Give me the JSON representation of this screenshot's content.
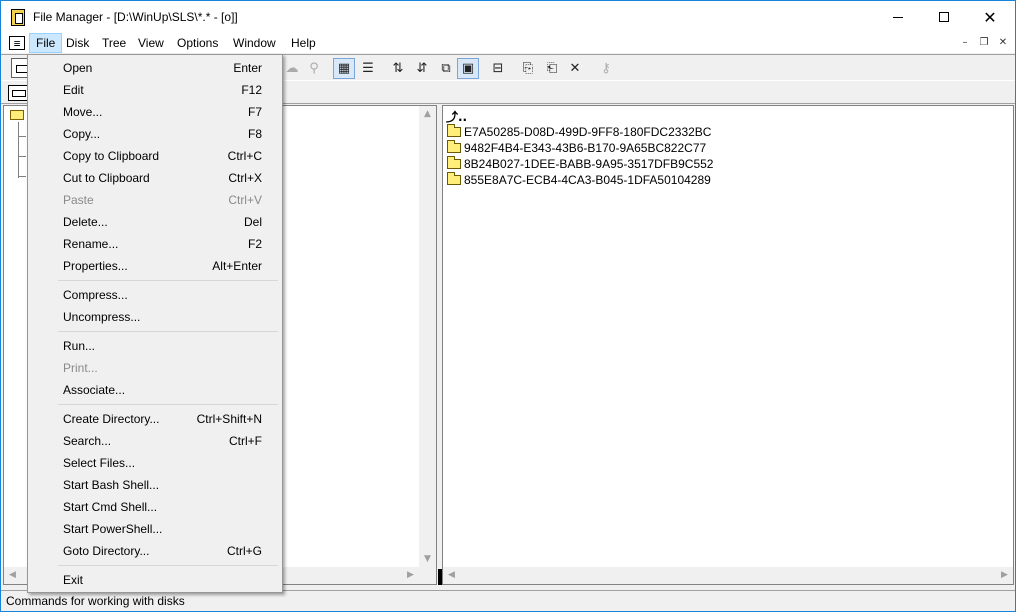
{
  "window": {
    "title": "File Manager - [D:\\WinUp\\SLS\\*.* - [o]]",
    "accent": "#1883d7"
  },
  "menubar": {
    "sys_icon": "≡",
    "items": [
      {
        "label": "File",
        "active": true
      },
      {
        "label": "Disk"
      },
      {
        "label": "Tree"
      },
      {
        "label": "View"
      },
      {
        "label": "Options"
      },
      {
        "label": "Window"
      },
      {
        "label": "Help"
      }
    ]
  },
  "file_pane": {
    "up_label": "⤴..",
    "items": [
      {
        "name": "E7A50285-D08D-499D-9FF8-180FDC2332BC"
      },
      {
        "name": "9482F4B4-E343-43B6-B170-9A65BC822C77"
      },
      {
        "name": "8B24B027-1DEE-BABB-9A95-3517DFB9C552"
      },
      {
        "name": "855E8A7C-ECB4-4CA3-B045-1DFA50104289"
      }
    ]
  },
  "status": {
    "text": "Commands for working with disks"
  },
  "file_menu": {
    "items": [
      {
        "label": "Open",
        "shortcut": "Enter"
      },
      {
        "label": "Edit",
        "shortcut": "F12"
      },
      {
        "label": "Move...",
        "shortcut": "F7"
      },
      {
        "label": "Copy...",
        "shortcut": "F8"
      },
      {
        "label": "Copy to Clipboard",
        "shortcut": "Ctrl+C"
      },
      {
        "label": "Cut to Clipboard",
        "shortcut": "Ctrl+X"
      },
      {
        "label": "Paste",
        "shortcut": "Ctrl+V",
        "disabled": true
      },
      {
        "label": "Delete...",
        "shortcut": "Del"
      },
      {
        "label": "Rename...",
        "shortcut": "F2"
      },
      {
        "label": "Properties...",
        "shortcut": "Alt+Enter"
      },
      {
        "label": "Compress...",
        "shortcut": ""
      },
      {
        "label": "Uncompress...",
        "shortcut": ""
      },
      {
        "label": "Run...",
        "shortcut": ""
      },
      {
        "label": "Print...",
        "shortcut": "",
        "disabled": true
      },
      {
        "label": "Associate...",
        "shortcut": ""
      },
      {
        "label": "Create Directory...",
        "shortcut": "Ctrl+Shift+N"
      },
      {
        "label": "Search...",
        "shortcut": "Ctrl+F"
      },
      {
        "label": "Select Files...",
        "shortcut": ""
      },
      {
        "label": "Start Bash Shell...",
        "shortcut": ""
      },
      {
        "label": "Start Cmd Shell...",
        "shortcut": ""
      },
      {
        "label": "Start PowerShell...",
        "shortcut": ""
      },
      {
        "label": "Goto Directory...",
        "shortcut": "Ctrl+G"
      },
      {
        "label": "Exit",
        "shortcut": ""
      }
    ]
  }
}
